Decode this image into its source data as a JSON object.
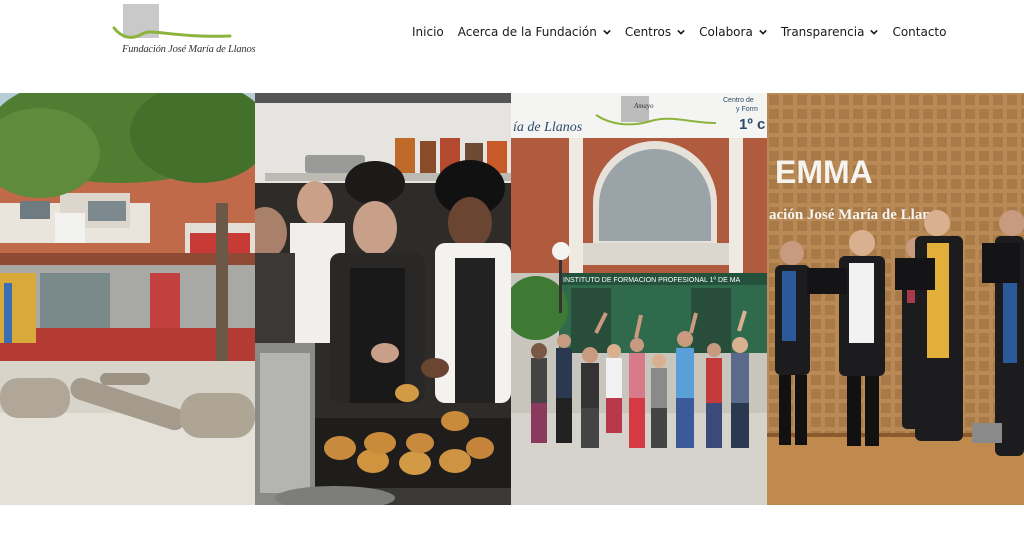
{
  "brand": {
    "name": "Fundación José María de Llanos",
    "logo_color": "#8cb43c"
  },
  "nav": {
    "items": [
      {
        "label": "Inicio",
        "has_dropdown": false
      },
      {
        "label": "Acerca de la Fundación",
        "has_dropdown": true
      },
      {
        "label": "Centros",
        "has_dropdown": true
      },
      {
        "label": "Colabora",
        "has_dropdown": true
      },
      {
        "label": "Transparencia",
        "has_dropdown": true
      },
      {
        "label": "Contacto",
        "has_dropdown": false
      }
    ]
  },
  "gallery": {
    "panels": [
      {
        "scene": "school-courtyard"
      },
      {
        "scene": "bakery-kitchen"
      },
      {
        "scene": "institute-entrance",
        "sign_top": "ía de Llanos",
        "sign_brand": "Amayo",
        "sign_right_1": "Centro de",
        "sign_right_2": "y Form",
        "sign_right_3": "1º c",
        "building_sign": "INSTITUTO DE FORMACION PROFESIONAL 1º DE MA"
      },
      {
        "scene": "choir-stage",
        "wall_title": "EMMA",
        "wall_subtitle": "ación José María de Llanos"
      }
    ]
  }
}
